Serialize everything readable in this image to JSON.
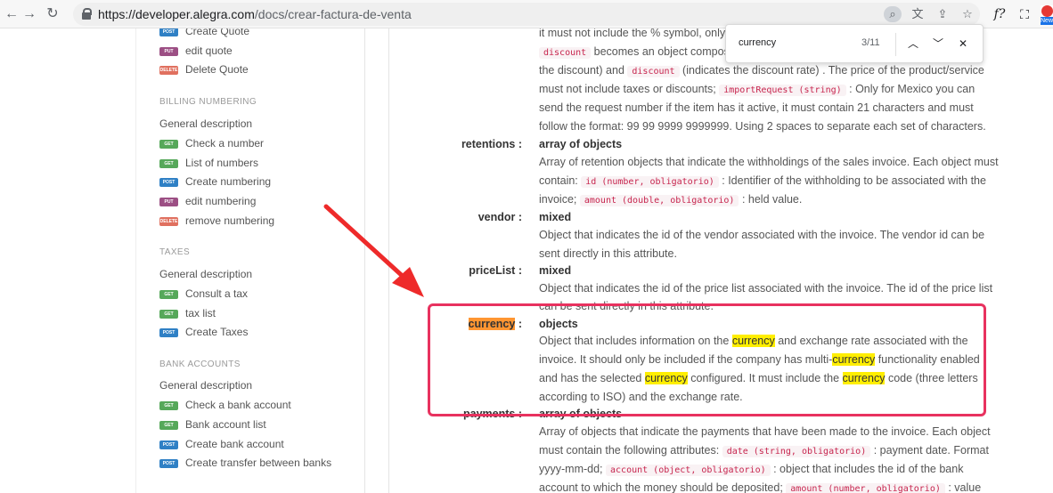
{
  "browser": {
    "url_host": "developer.alegra.com",
    "url_path": "/docs/crear-factura-de-venta",
    "ext_badge": "New"
  },
  "find": {
    "query": "currency",
    "count": "3/11"
  },
  "sidebar": {
    "top_items": [
      {
        "method": "POST",
        "label": "Create Quote"
      },
      {
        "method": "PUT",
        "label": "edit quote"
      },
      {
        "method": "DELETE",
        "label": "Delete Quote"
      }
    ],
    "billing": {
      "title": "BILLING NUMBERING",
      "desc": "General description",
      "items": [
        {
          "method": "GET",
          "label": "Check a number"
        },
        {
          "method": "GET",
          "label": "List of numbers"
        },
        {
          "method": "POST",
          "label": "Create numbering"
        },
        {
          "method": "PUT",
          "label": "edit numbering"
        },
        {
          "method": "DELETE",
          "label": "remove numbering"
        }
      ]
    },
    "taxes": {
      "title": "TAXES",
      "desc": "General description",
      "items": [
        {
          "method": "GET",
          "label": "Consult a tax"
        },
        {
          "method": "GET",
          "label": "tax list"
        },
        {
          "method": "POST",
          "label": "Create Taxes"
        }
      ]
    },
    "bank": {
      "title": "BANK ACCOUNTS",
      "desc": "General description",
      "items": [
        {
          "method": "GET",
          "label": "Check a bank account"
        },
        {
          "method": "GET",
          "label": "Bank account list"
        },
        {
          "method": "POST",
          "label": "Create bank account"
        },
        {
          "method": "POST",
          "label": "Create transfer between banks"
        }
      ]
    }
  },
  "doc": {
    "l1": "it must not include the % symbol, only",
    "l2_code": "discount",
    "l2_text": "becomes an object compos",
    "l3_a": "the discount) and",
    "l3_code": "discount",
    "l3_b": "(indicates the discount rate) . The price of the product/service",
    "l4_a": "must not include taxes or discounts;",
    "l4_code": "importRequest (string)",
    "l4_b": ": Only for Mexico you can",
    "l5": "send the request number if the item has it active, it must contain 21 characters and must",
    "l6": "follow the format: 99 99 9999 9999999. Using 2 spaces to separate each set of characters.",
    "retentions_label": "retentions :",
    "retentions_type": "array of objects",
    "r1": "Array of retention objects that indicate the withholdings of the sales invoice. Each object must",
    "r2_a": "contain:",
    "r2_code": "id (number, obligatorio)",
    "r2_b": ": Identifier of the withholding to be associated with the",
    "r3_a": "invoice;",
    "r3_code": "amount (double, obligatorio)",
    "r3_b": ": held value.",
    "vendor_label": "vendor :",
    "vendor_type": "mixed",
    "v1": "Object that indicates the id of the vendor associated with the invoice. The vendor id can be",
    "v2": "sent directly in this attribute.",
    "pricelist_label": "priceList :",
    "pricelist_type": "mixed",
    "p1": "Object that indicates the id of the price list associated with the invoice. The id of the price list",
    "p2": "can be sent directly in this attribute.",
    "currency_label": "currency",
    "currency_colon": ":",
    "currency_type": "objects",
    "c1_a": "Object that includes information on the",
    "c1_hl": "currency",
    "c1_b": "and exchange rate associated with the",
    "c2_a": "invoice. It should only be included if the company has multi-",
    "c2_hl": "currency",
    "c2_b": "functionality enabled",
    "c3_a": "and has the selected",
    "c3_hl": "currency",
    "c3_b": "configured. It must include the",
    "c3_hl2": "currency",
    "c3_c": "code (three letters",
    "c4": "according to ISO) and the exchange rate.",
    "payments_label": "payments :",
    "payments_type": "array of objects",
    "pay1": "Array of objects that indicate the payments that have been made to the invoice. Each object",
    "pay2_a": "must contain the following attributes:",
    "pay2_code": "date (string, obligatorio)",
    "pay2_b": ": payment date. Format",
    "pay3_a": "yyyy-mm-dd;",
    "pay3_code": "account (object, obligatorio)",
    "pay3_b": ": object that includes the id of the bank",
    "pay4_a": "account to which the money should be deposited;",
    "pay4_code": "amount (number, obligatorio)",
    "pay4_b": ": value"
  },
  "colors": {
    "highlight_box": "#e8325f",
    "arrow": "#ee2a2a",
    "find_match": "#ffee00",
    "find_current": "#ff9632"
  }
}
